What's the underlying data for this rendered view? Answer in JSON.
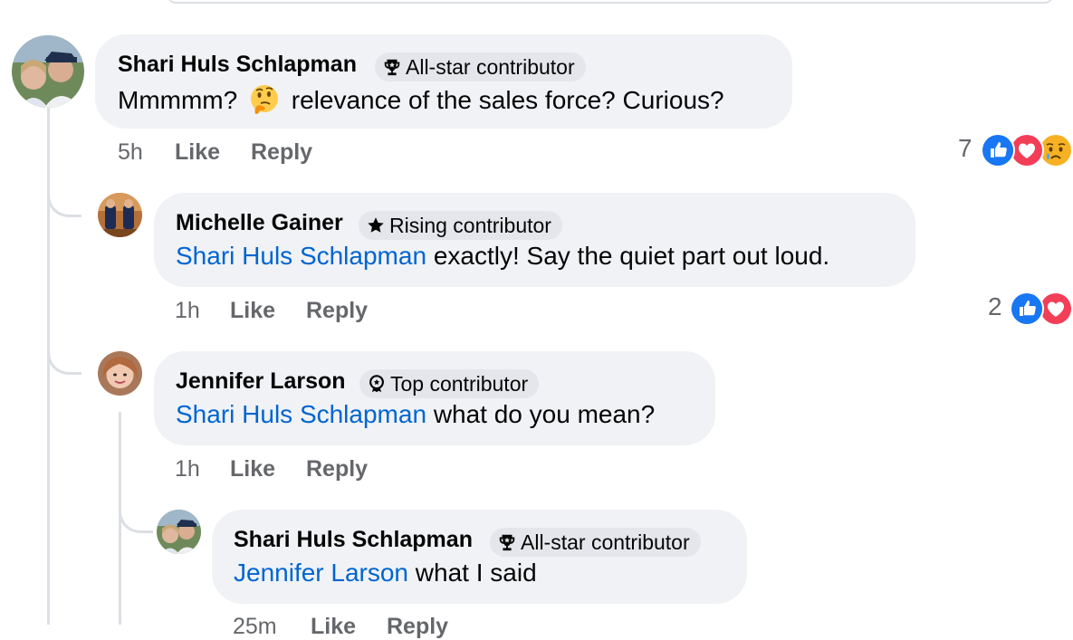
{
  "comments": [
    {
      "author": "Shari Huls Schlapman",
      "badge": "All-star contributor",
      "badge_icon": "trophy-icon",
      "text_before_emoji": "Mmmmm?",
      "emoji": "thinking-face-emoji",
      "text_after_emoji": "relevance of the sales force? Curious?",
      "time": "5h",
      "like_label": "Like",
      "reply_label": "Reply",
      "reaction_count": "7",
      "reactions": [
        "like-reaction-icon",
        "love-reaction-icon",
        "sad-reaction-icon"
      ]
    },
    {
      "author": "Michelle Gainer",
      "badge": "Rising contributor",
      "badge_icon": "star-icon",
      "mention": "Shari Huls Schlapman",
      "text": "exactly! Say the quiet part out loud.",
      "time": "1h",
      "like_label": "Like",
      "reply_label": "Reply",
      "reaction_count": "2",
      "reactions": [
        "like-reaction-icon",
        "love-reaction-icon"
      ]
    },
    {
      "author": "Jennifer Larson",
      "badge": "Top contributor",
      "badge_icon": "medal-icon",
      "mention": "Shari Huls Schlapman",
      "text": "what do you mean?",
      "time": "1h",
      "like_label": "Like",
      "reply_label": "Reply"
    },
    {
      "author": "Shari Huls Schlapman",
      "badge": "All-star contributor",
      "badge_icon": "trophy-icon",
      "mention": "Jennifer Larson",
      "text": "what I said",
      "time": "25m",
      "like_label": "Like",
      "reply_label": "Reply"
    }
  ],
  "colors": {
    "bubble": "#f0f2f5",
    "badge": "#e4e6eb",
    "mention": "#0064d1",
    "meta": "#65676b",
    "like": "#1877f2",
    "love": "#f33e58"
  }
}
